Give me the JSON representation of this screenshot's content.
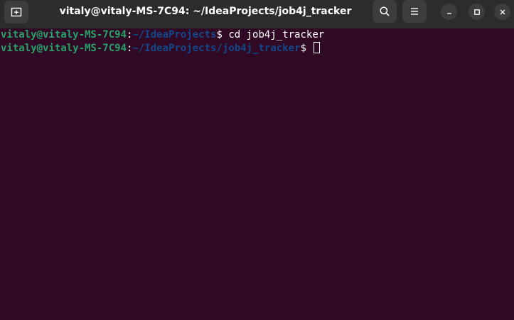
{
  "window": {
    "title": "vitaly@vitaly-MS-7C94: ~/IdeaProjects/job4j_tracker",
    "background_color": "#300a24",
    "titlebar_color": "#2c2c2c"
  },
  "titlebar": {
    "new_tab_icon": "new-tab-icon",
    "search_icon": "search-icon",
    "menu_icon": "hamburger-menu-icon",
    "minimize_icon": "minimize-icon",
    "maximize_icon": "maximize-icon",
    "close_icon": "close-icon"
  },
  "terminal": {
    "prompt_color_user": "#26a269",
    "prompt_color_path": "#12488b",
    "lines": [
      {
        "user_host": "vitaly@vitaly-MS-7C94",
        "colon": ":",
        "path": "~/IdeaProjects",
        "dollar": "$",
        "command": " cd job4j_tracker"
      },
      {
        "user_host": "vitaly@vitaly-MS-7C94",
        "colon": ":",
        "path": "~/IdeaProjects/job4j_tracker",
        "dollar": "$",
        "command": " "
      }
    ]
  }
}
